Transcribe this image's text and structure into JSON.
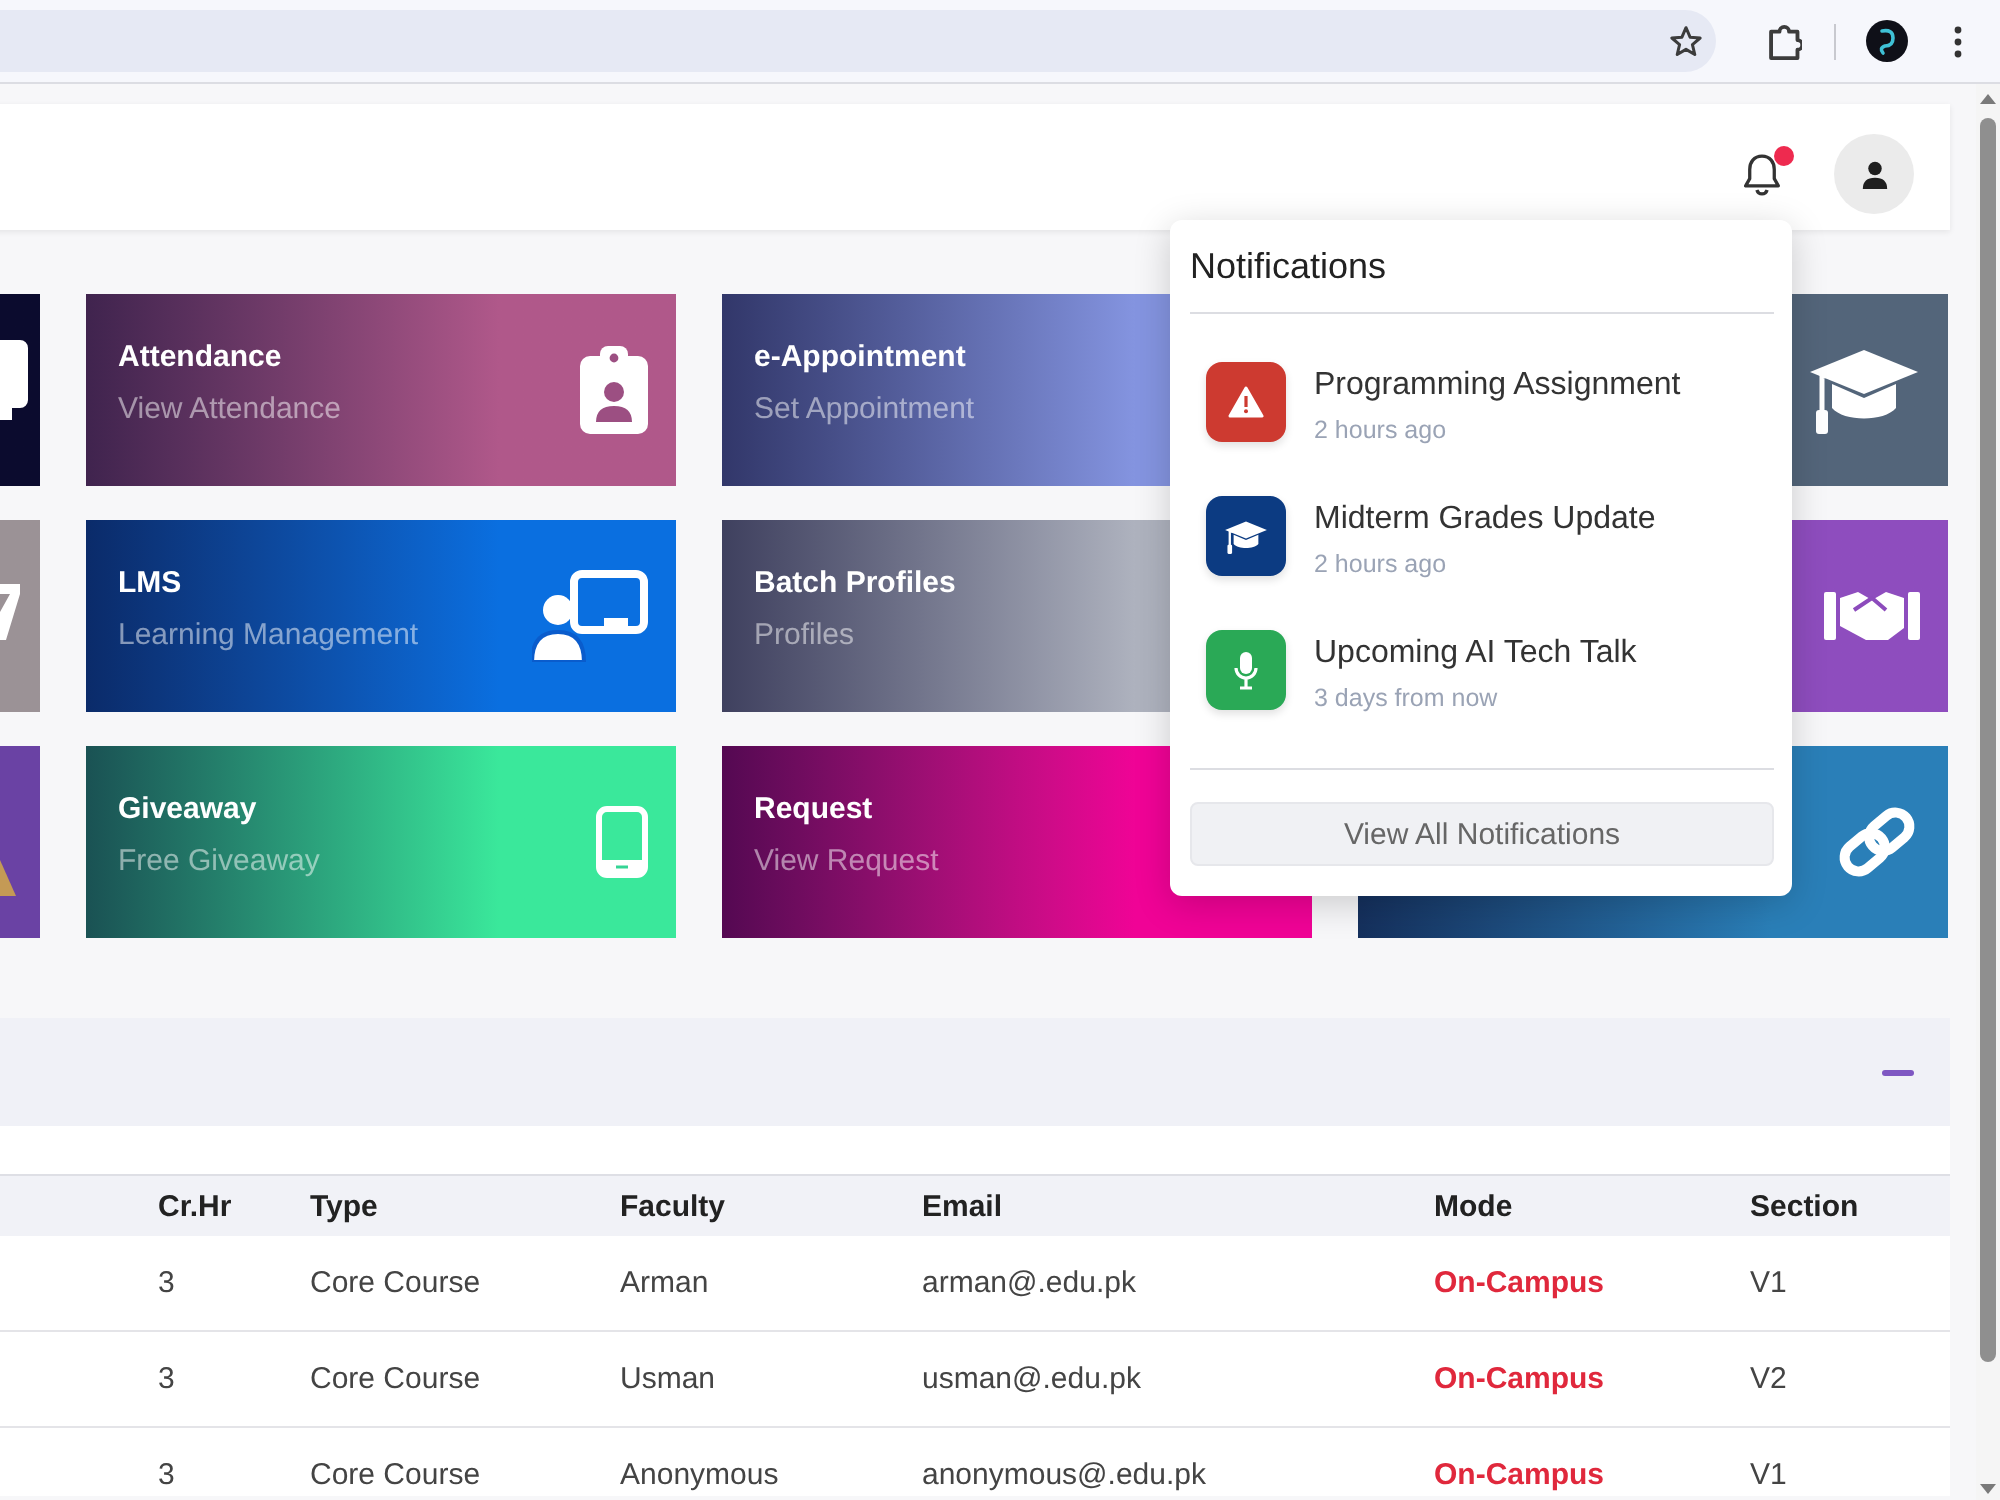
{
  "header": {
    "unread_notifications": true
  },
  "notifications": {
    "title": "Notifications",
    "items": [
      {
        "kind": "warning",
        "color": "#cd3a30",
        "title": "Programming Assignment",
        "time": "2 hours ago"
      },
      {
        "kind": "graduation",
        "color": "#0c3b82",
        "title": "Midterm Grades Update",
        "time": "2 hours ago"
      },
      {
        "kind": "microphone",
        "color": "#2aa956",
        "title": "Upcoming AI Tech Talk",
        "time": "3 days from now"
      }
    ],
    "button": "View All Notifications"
  },
  "tiles": [
    {
      "kind": "monitor",
      "color": "#0b0b2e"
    },
    {
      "title": "Attendance",
      "subtitle": "View Attendance",
      "kind": "badge",
      "color": "#b0588a"
    },
    {
      "title": "e-Appointment",
      "subtitle": "Set Appointment",
      "color": "#8494e0"
    },
    {
      "kind": "graduation",
      "color": "#53657a"
    },
    {
      "kind": "slash",
      "color": "#9b9296"
    },
    {
      "title": "LMS",
      "subtitle": "Learning Management",
      "kind": "teacher",
      "color": "#0a6fe0"
    },
    {
      "title": "Batch Profiles",
      "subtitle": "Profiles",
      "color": "#aeb2be"
    },
    {
      "kind": "handshake",
      "color": "#8e4dbe"
    },
    {
      "kind": "triangle",
      "color": "#6a42a4"
    },
    {
      "title": "Giveaway",
      "subtitle": "Free Giveaway",
      "kind": "phone",
      "color": "#3ae89b"
    },
    {
      "title": "Request",
      "subtitle": "View Request",
      "color": "#f00396"
    },
    {
      "kind": "link",
      "color": "#2a7fb8"
    }
  ],
  "section": {
    "expanded": true
  },
  "table": {
    "columns": [
      "Cr.Hr",
      "Type",
      "Faculty",
      "Email",
      "Mode",
      "Section"
    ],
    "rows": [
      {
        "cells": [
          "3",
          "Core Course",
          "Arman",
          "arman@.edu.pk",
          "On-Campus",
          "V1"
        ]
      },
      {
        "cells": [
          "3",
          "Core Course",
          "Usman",
          "usman@.edu.pk",
          "On-Campus",
          "V2"
        ]
      },
      {
        "cells": [
          "3",
          "Core Course",
          "Anonymous",
          "anonymous@.edu.pk",
          "On-Campus",
          "V1"
        ]
      }
    ]
  }
}
